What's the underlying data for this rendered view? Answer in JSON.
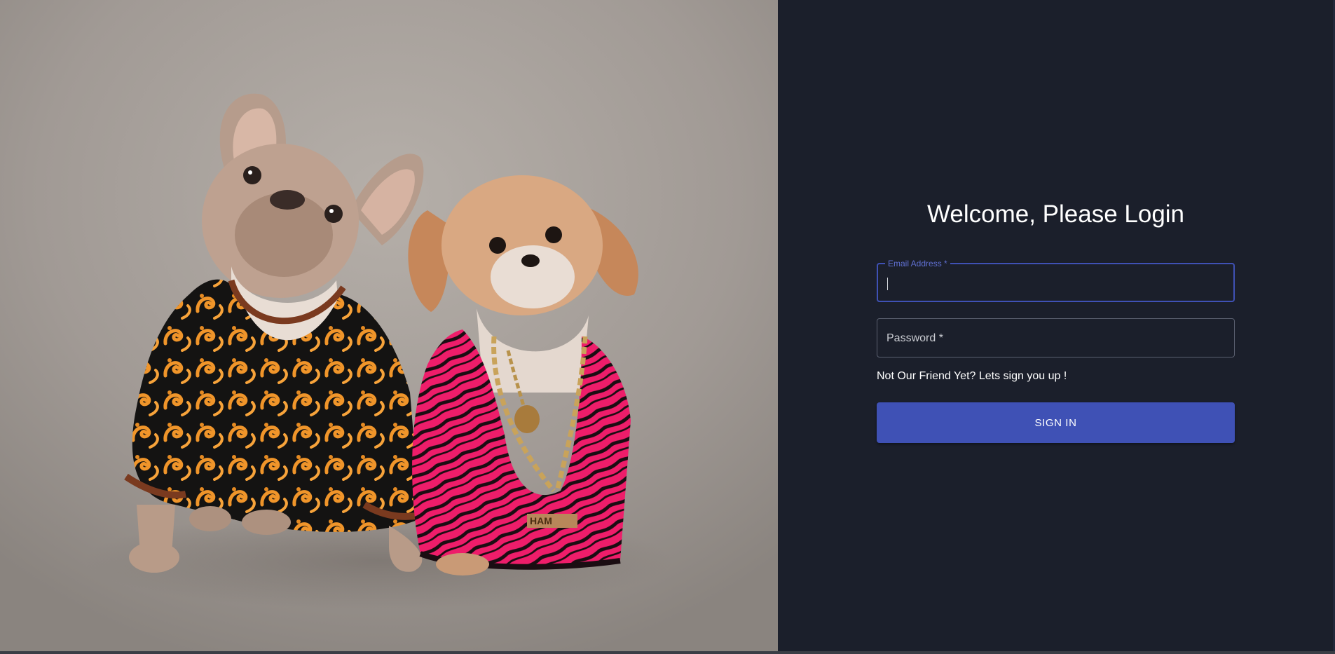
{
  "page": {
    "title": "Welcome, Please Login"
  },
  "form": {
    "email": {
      "label": "Email Address *",
      "value": ""
    },
    "password": {
      "label": "Password *",
      "value": ""
    },
    "signup_text": "Not Our Friend Yet? Lets sign you up !",
    "submit_label": "SIGN IN"
  },
  "hero": {
    "tag_text": "HAM"
  },
  "colors": {
    "panel_bg": "#1b1f2b",
    "accent": "#3f51b5"
  }
}
